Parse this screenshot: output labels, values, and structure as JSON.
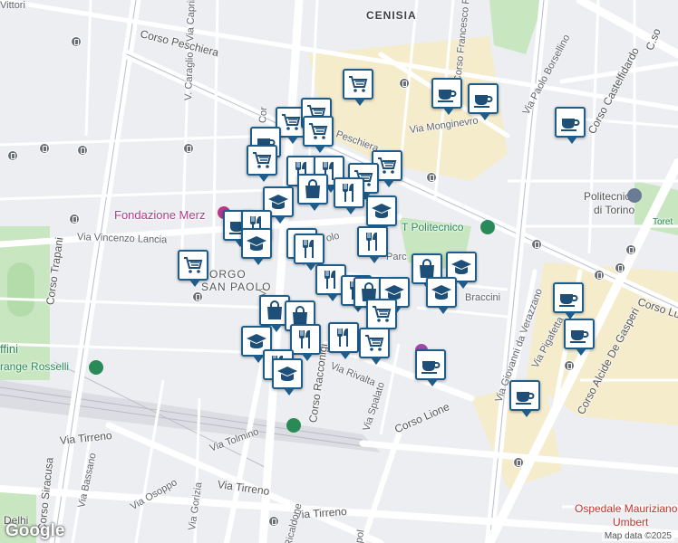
{
  "map": {
    "neighborhoods": {
      "cenisia": "CENISIA",
      "borgo": "BORGO",
      "san_paolo": "SAN PAOLO"
    },
    "streets": {
      "corso_peschiera": "Corso Peschiera",
      "corso_trapani": "Corso Trapani",
      "via_caprilio": "Via Caprilio",
      "v_caraglio": "V. Caraglio",
      "corso_francesco_ferrucci": "Corso Francesco Fe",
      "via_monginevro": "Via Monginevro",
      "via_paolo_borsellino": "Via Paolo Borsellino",
      "corso_castelfidardo": "Corso Castelfidardo",
      "via_vincenzo_lancia": "Via Vincenzo Lancia",
      "corso_racconigi": "Corso Racconigi",
      "via_rivalta": "Via Rivalta",
      "via_spalato": "Via Spalato",
      "corso_lione": "Corso Lione",
      "via_braccini": "Braccini",
      "via_tolmino": "Via Tolmino",
      "via_tirreno_1": "Via Tirreno",
      "via_tirreno_2": "Via Tirreno",
      "via_tirreno_3": "Via Tirreno",
      "via_bassano": "Via Bassano",
      "via_osoppo": "Via Osoppo",
      "via_gorizia": "Via Gorizia",
      "ricaldone": "Ricaldone",
      "corso_siracusa": "Corso Siracusa",
      "via_giovanni_verazzano": "Via Giovanni da Verazzano",
      "via_pigafetta": "Via Pigafetta",
      "corso_alcide_de_gasperi": "Corso Alcide De Gasperi",
      "corso_lu": "Corso Lu",
      "cso": "C.so",
      "vittori": "Vittori",
      "corso_peschiera_2": "Peschiera",
      "v_caraglio_2": "Vi",
      "via_pol": "pol",
      "cor": "Cor",
      "dolo": "olo",
      "parc": "Parc",
      "pol_bottom": "pol"
    },
    "pois": {
      "fondazione_merz": "Fondazione Merz",
      "politecnico": "Politecnico\ndi Torino",
      "politecnico_line1": "Politecnico",
      "politecnico_line2": "di Torino",
      "politecnico_stop": "T Politecnico",
      "orange_rosselli": "range Rosselli",
      "affini": "ffini",
      "ospedale_line1": "Ospedale Mauriziano",
      "ospedale_line2": "Umbert",
      "dolhi": "Delhi",
      "toret": "Toret"
    },
    "attribution": "Map data ©2025",
    "logo": "Google"
  },
  "markers": [
    {
      "type": "grocery",
      "icon": "cart-icon"
    },
    {
      "type": "cafe",
      "icon": "coffee-icon"
    },
    {
      "type": "restaurant",
      "icon": "fork-knife-icon"
    },
    {
      "type": "shopping",
      "icon": "bag-icon"
    },
    {
      "type": "school",
      "icon": "graduation-cap-icon"
    }
  ],
  "colors": {
    "marker_border": "#1d5d8c",
    "park": "#c8e6c0",
    "highlight": "#f5eccc",
    "road": "#ffffff",
    "background": "#eceef2"
  }
}
